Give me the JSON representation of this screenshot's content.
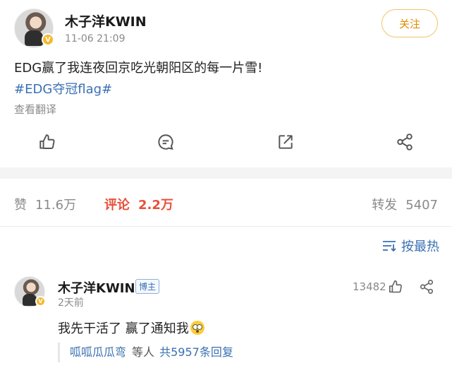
{
  "post": {
    "username": "木子洋KWIN",
    "time": "11-06 21:09",
    "follow_label": "关注",
    "text": "EDG赢了我连夜回京吃光朝阳区的每一片雪!",
    "hashtag": "#EDG夺冠flag#",
    "translate_label": "查看翻译",
    "verified_badge": "V"
  },
  "actions": [
    {
      "icon": "like-icon"
    },
    {
      "icon": "comment-icon"
    },
    {
      "icon": "repost-icon"
    },
    {
      "icon": "share-icon"
    }
  ],
  "stats": {
    "like_label": "赞",
    "like_count": "11.6万",
    "comment_label": "评论",
    "comment_count": "2.2万",
    "repost_label": "转发",
    "repost_count": "5407"
  },
  "sort": {
    "label": "按最热",
    "icon": "sort-icon"
  },
  "comment": {
    "username": "木子洋KWIN",
    "badge": "博主",
    "time": "2天前",
    "likes": "13482",
    "text": "我先干活了 赢了通知我",
    "emoji": "flushed-face-emoji",
    "reply_user": "呱呱瓜瓜弯",
    "reply_etc": "等人",
    "reply_count": "共5957条回复"
  },
  "colors": {
    "accent_blue": "#3a70b2",
    "follow_orange": "#e28b00",
    "comment_red": "#e8503a",
    "verified_gold": "#f5b82e"
  }
}
